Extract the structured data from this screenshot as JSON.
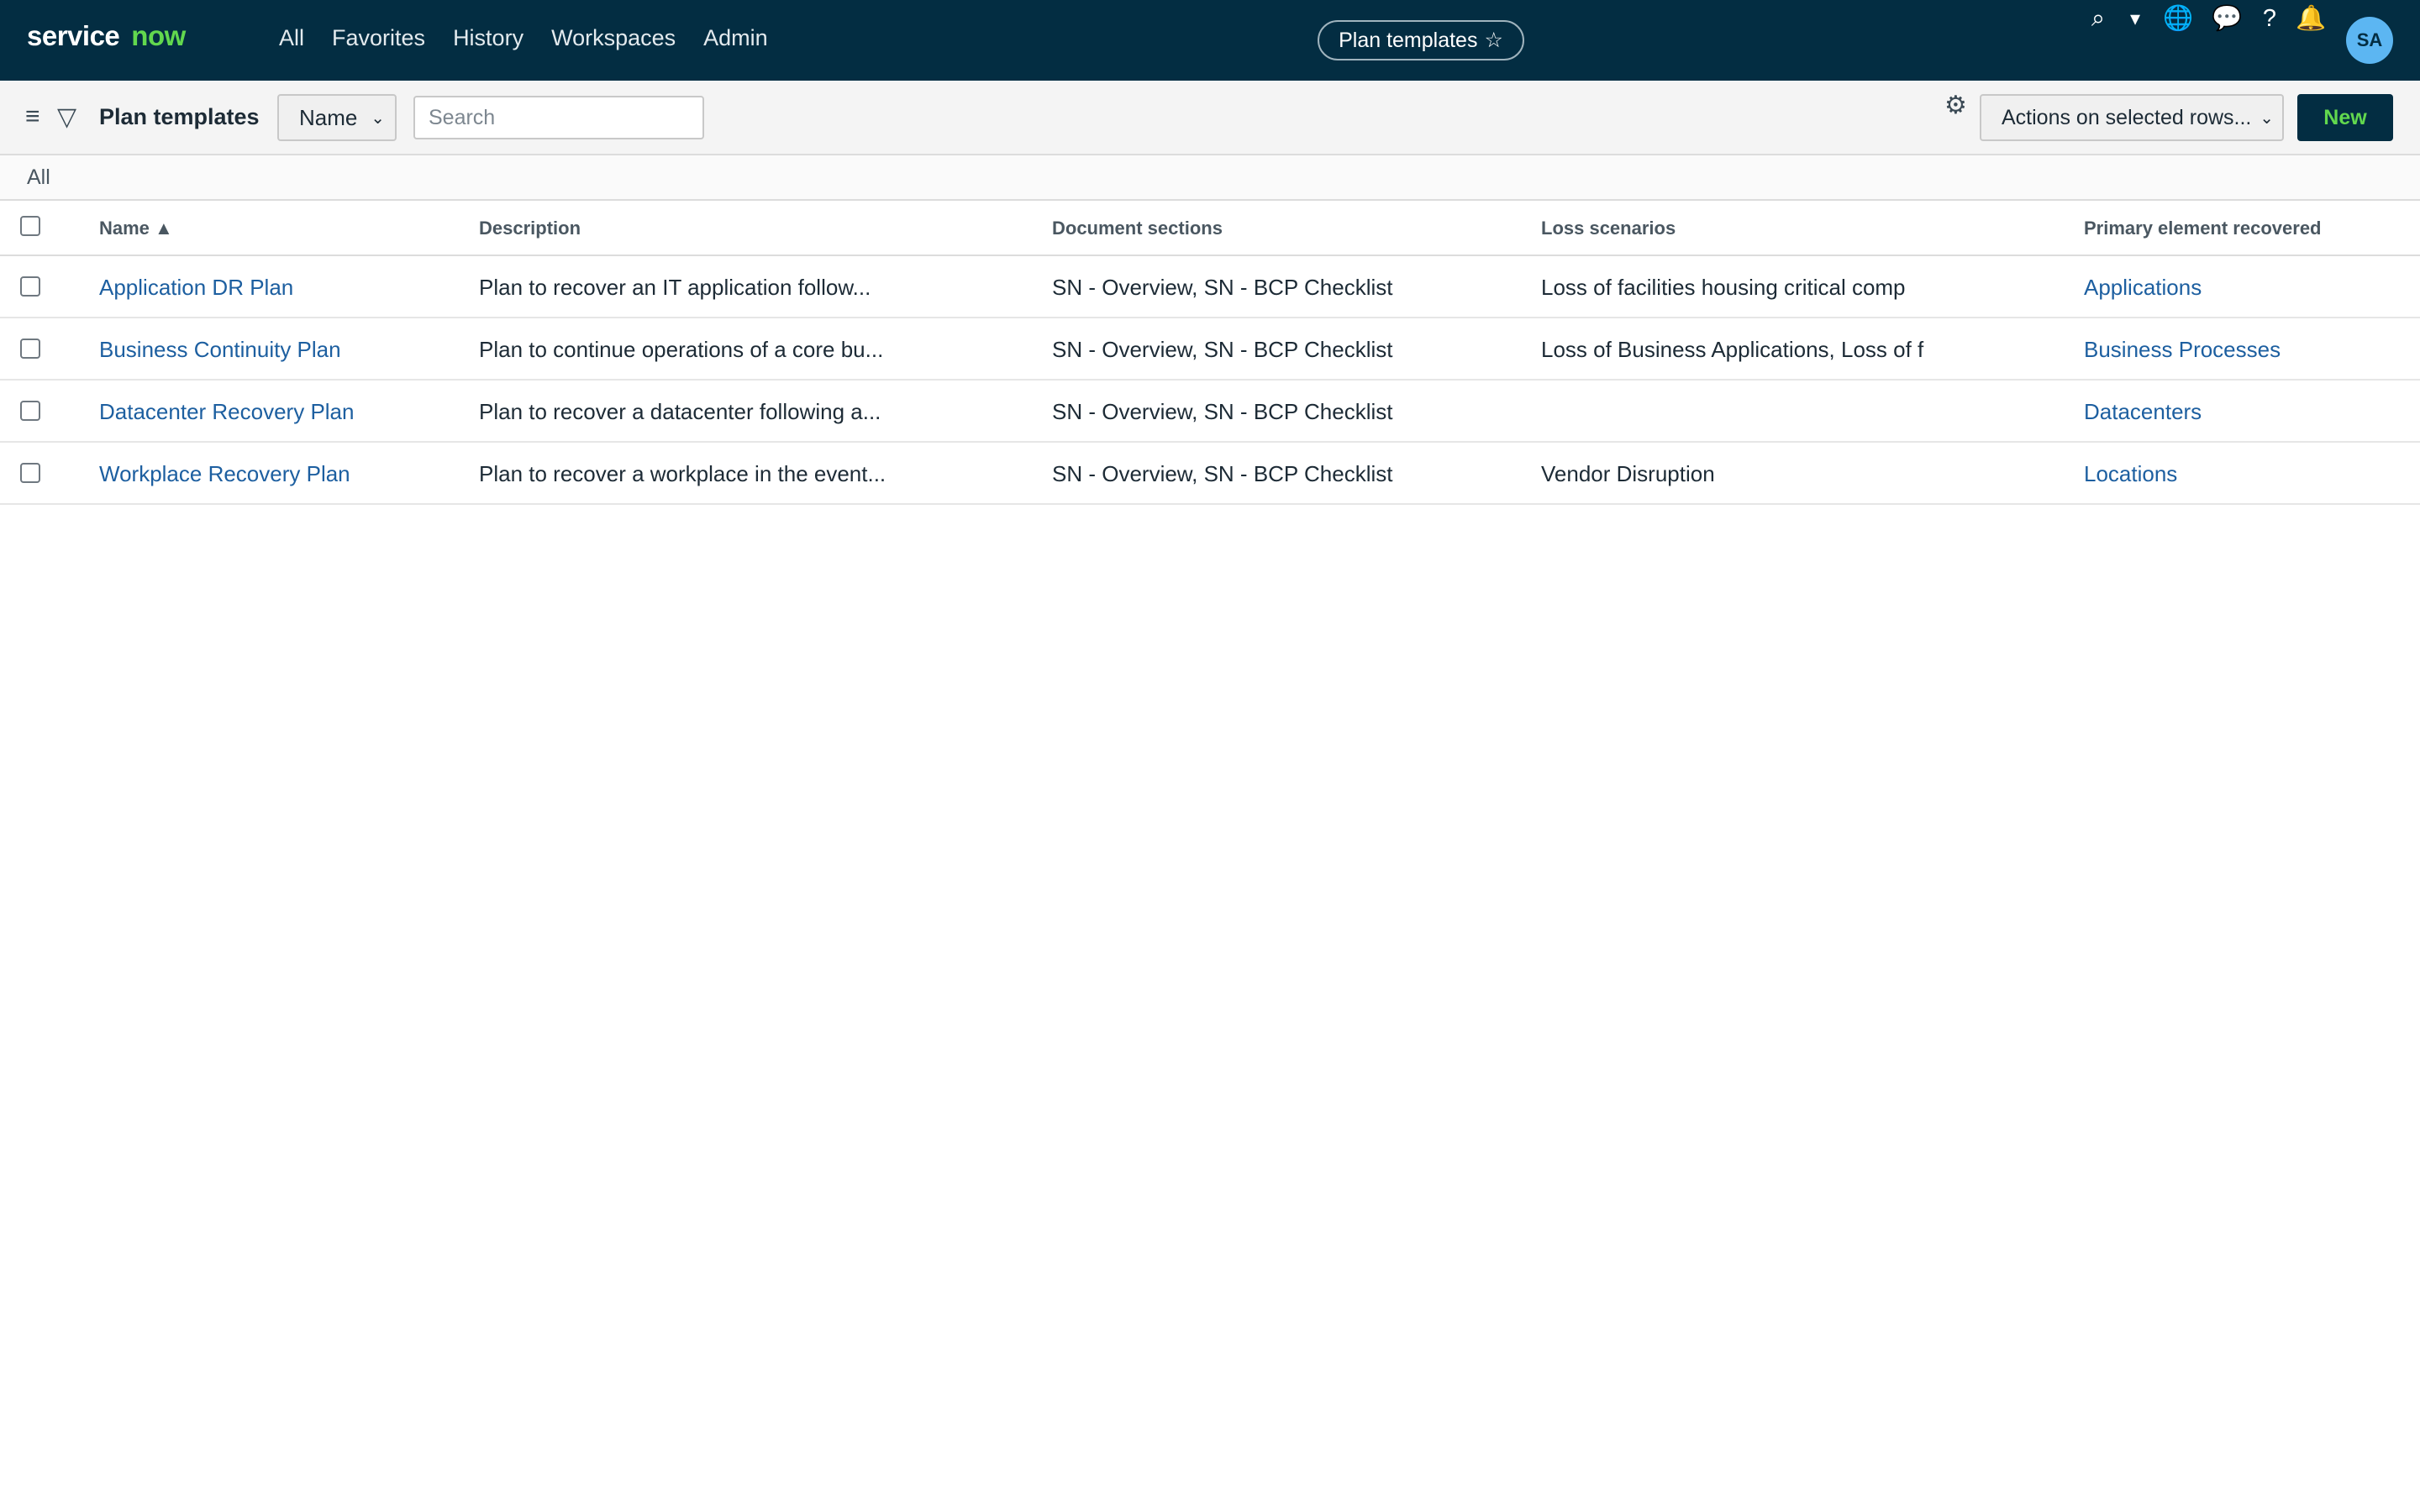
{
  "header": {
    "logo_primary": "service",
    "logo_secondary": "now",
    "nav": [
      "All",
      "Favorites",
      "History",
      "Workspaces",
      "Admin"
    ],
    "context_pill": "Plan templates",
    "context_star": "☆",
    "avatar_initials": "SA",
    "colors": {
      "bar": "#032d42",
      "accent": "#62d84e",
      "avatar": "#5cb6f2"
    }
  },
  "icons": {
    "search": "⌕",
    "dropdown": "▾",
    "globe": "🌐",
    "chat": "💬",
    "help": "?",
    "bell": "🔔",
    "menu": "≡",
    "filter": "▽",
    "gear": "⚙",
    "chevron": "⌄"
  },
  "toolbar": {
    "title": "Plan templates",
    "field_select_value": "Name",
    "search_placeholder": "Search",
    "actions_select_value": "Actions on selected rows...",
    "new_label": "New"
  },
  "breadcrumb": "All",
  "table": {
    "columns": [
      "Name ▲",
      "Description",
      "Document sections",
      "Loss scenarios",
      "Primary element recovered"
    ],
    "rows": [
      {
        "name": "Application DR Plan",
        "description": "Plan to recover an IT application follow...",
        "document_sections": "SN - Overview, SN - BCP Checklist",
        "loss_scenarios": "Loss of facilities housing critical comp",
        "primary_element": "Applications"
      },
      {
        "name": "Business Continuity Plan",
        "description": "Plan to continue operations of a core bu...",
        "document_sections": "SN - Overview, SN - BCP Checklist",
        "loss_scenarios": "Loss of Business Applications, Loss of f",
        "primary_element": "Business Processes"
      },
      {
        "name": "Datacenter Recovery Plan",
        "description": "Plan to recover a datacenter following a...",
        "document_sections": "SN - Overview, SN - BCP Checklist",
        "loss_scenarios": "",
        "primary_element": "Datacenters"
      },
      {
        "name": "Workplace Recovery Plan",
        "description": "Plan to recover a workplace in the event...",
        "document_sections": "SN - Overview, SN - BCP Checklist",
        "loss_scenarios": "Vendor Disruption",
        "primary_element": "Locations"
      }
    ]
  }
}
